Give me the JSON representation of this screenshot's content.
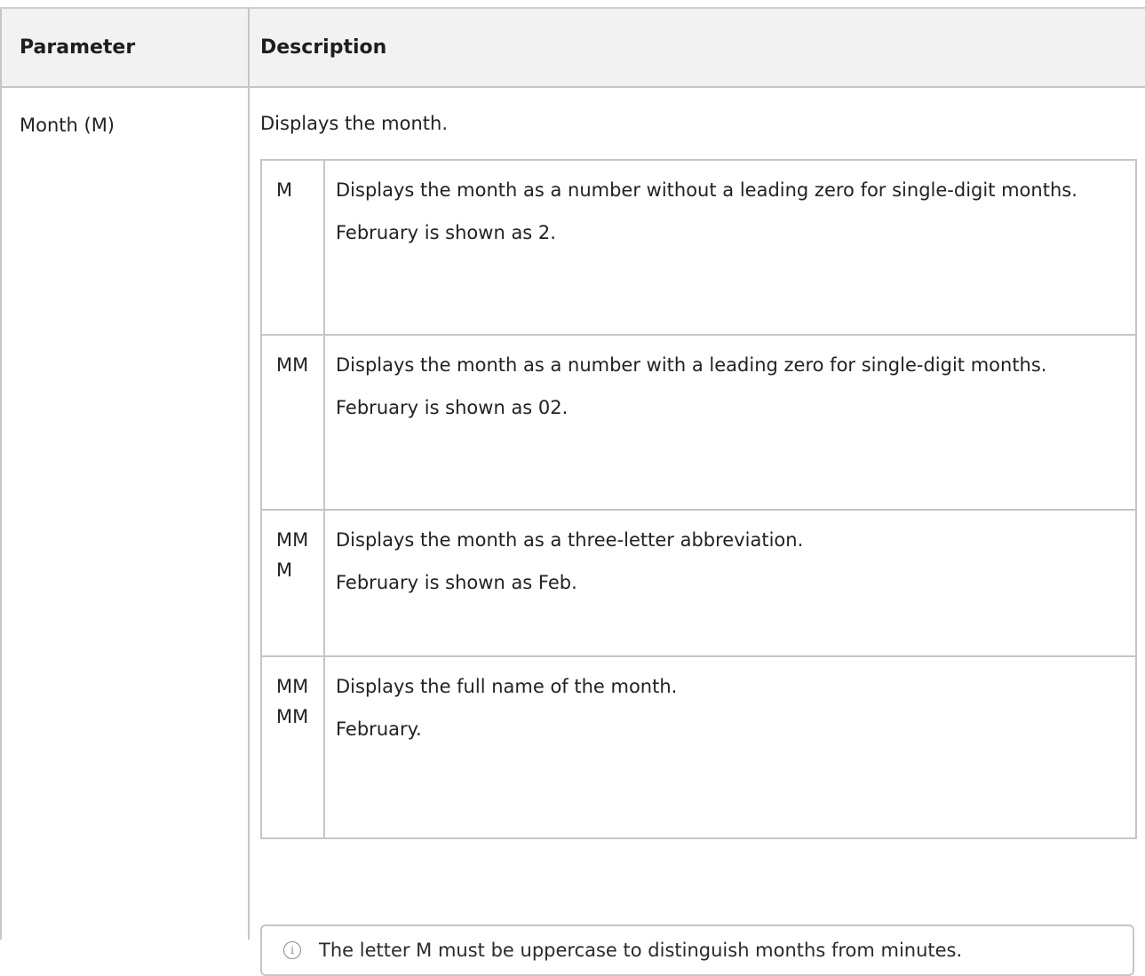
{
  "table": {
    "headers": [
      "Parameter",
      "Description"
    ],
    "rows": [
      {
        "parameter": "Month (M)",
        "description": "Displays the month.",
        "formats": [
          {
            "code": "M",
            "description": "Displays the month as a number without a leading zero for single-digit months.",
            "example": "February is shown as 2."
          },
          {
            "code": "MM",
            "description": "Displays the month as a number with a leading zero for single-digit months.",
            "example": "February is shown as 02."
          },
          {
            "code": "MMM",
            "description": "Displays the month as a three-letter abbreviation.",
            "example": "February is shown as Feb."
          },
          {
            "code": "MMMM",
            "description": "Displays the full name of the month.",
            "example": "February."
          }
        ],
        "note": {
          "icon": "info-icon",
          "text": "The letter M must be uppercase to distinguish months from minutes."
        }
      }
    ]
  }
}
